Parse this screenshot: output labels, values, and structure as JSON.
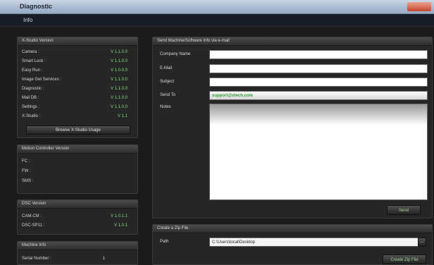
{
  "window": {
    "title": "Diagnostic"
  },
  "menu": {
    "info": "Info"
  },
  "versions": {
    "header": "X-Studio Version",
    "rows": [
      {
        "label": "Camera :",
        "value": "V 1.1.0.0"
      },
      {
        "label": "Smart Lock :",
        "value": "V 1.1.0.0"
      },
      {
        "label": "Easy Run :",
        "value": "V 1.0.0.0"
      },
      {
        "label": "Image Get Services :",
        "value": "V 1.1.0.0"
      },
      {
        "label": "Diagnostic :",
        "value": "V 1.1.0.0"
      },
      {
        "label": "Mail DB :",
        "value": "V 1.1.0.0"
      },
      {
        "label": "Settings :",
        "value": "V 1.1.0.0"
      },
      {
        "label": "X-Studio :",
        "value": "V 1.1"
      }
    ],
    "button": "Browse X-Studio Usage"
  },
  "motion": {
    "header": "Motion Controller Version",
    "rows": [
      {
        "label": "FC :",
        "value": ""
      },
      {
        "label": "FW :",
        "value": ""
      },
      {
        "label": "SMS :",
        "value": ""
      }
    ]
  },
  "dsc": {
    "header": "DSC Version",
    "rows": [
      {
        "label": "CAM-CM :",
        "value": "V 1.0.1.1"
      },
      {
        "label": "DSC-SP11 :",
        "value": "V 1.0.1"
      }
    ]
  },
  "machine": {
    "header": "Machine Info",
    "rows": [
      {
        "label": "Serial Number :",
        "value": "1"
      }
    ]
  },
  "email": {
    "header": "Send Machine/Software Info via e-mail",
    "company_label": "Company Name",
    "email_label": "E-Mail",
    "subject_label": "Subject",
    "send_to_label": "Send To",
    "send_to_value": "support@xtech.com",
    "notes_label": "Notes",
    "send_button": "Send"
  },
  "zip": {
    "header": "Create a Zip File",
    "path_label": "Path",
    "path_value": "C:\\Users\\local\\Desktop",
    "browse_button": "...",
    "create_button": "Create Zip File"
  }
}
